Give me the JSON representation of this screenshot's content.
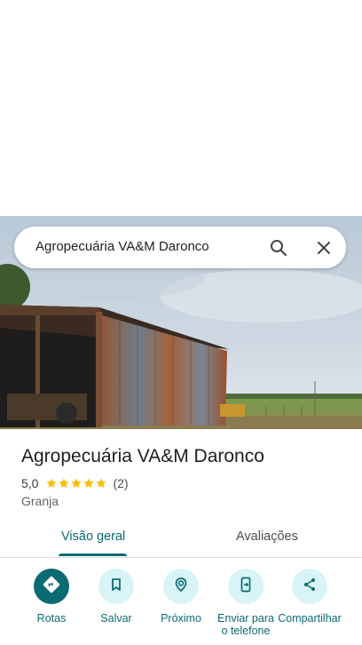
{
  "search": {
    "query": "Agropecuária VA&M Daronco"
  },
  "place": {
    "name": "Agropecuária VA&M Daronco",
    "rating": "5,0",
    "stars": 5,
    "review_count": "(2)",
    "category": "Granja"
  },
  "tabs": [
    {
      "label": "Visão geral",
      "active": true
    },
    {
      "label": "Avaliações",
      "active": false
    }
  ],
  "actions": [
    {
      "label": "Rotas",
      "icon": "directions-icon"
    },
    {
      "label": "Salvar",
      "icon": "bookmark-icon"
    },
    {
      "label": "Próximo",
      "icon": "nearby-icon"
    },
    {
      "label": "Enviar para o telefone",
      "icon": "send-to-phone-icon"
    },
    {
      "label": "Compartilhar",
      "icon": "share-icon"
    }
  ],
  "colors": {
    "accent": "#0b6b73",
    "action_bg": "#d8f4f6",
    "star": "#fbbc04"
  }
}
